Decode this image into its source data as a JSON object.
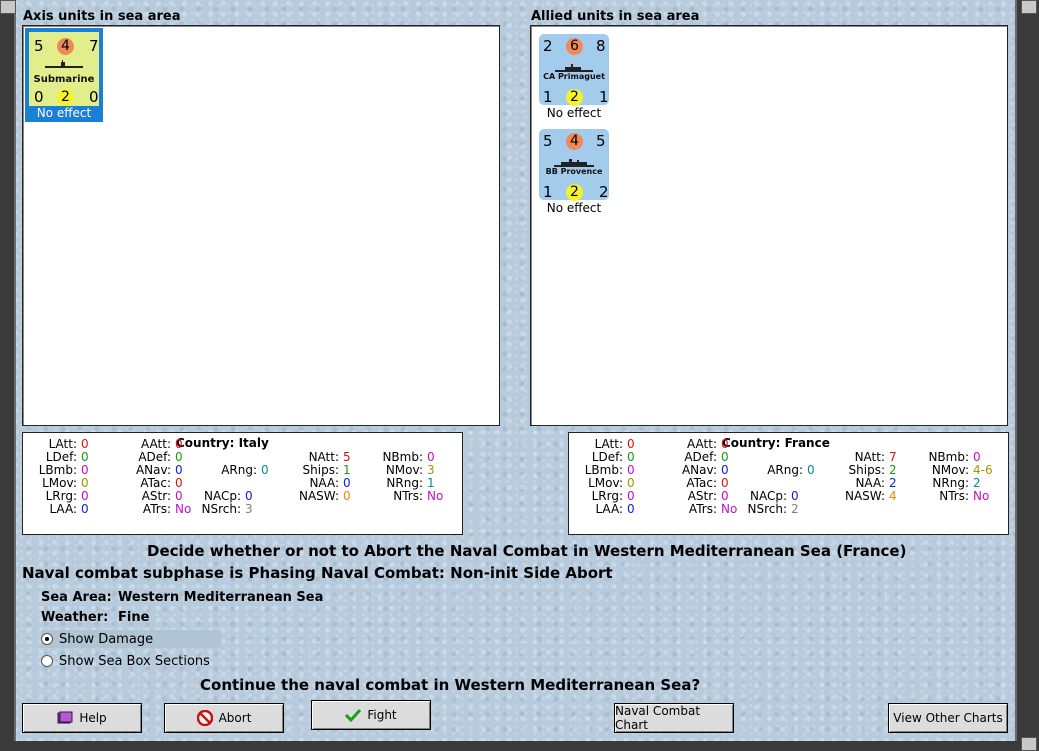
{
  "axis": {
    "title": "Axis units in sea area",
    "units": [
      {
        "name": "Submarine",
        "top_left": "5",
        "top_mid": "4",
        "top_right": "7",
        "bot_left": "0",
        "bot_mid": "2",
        "bot_right": "0",
        "effect": "No effect",
        "selected": true
      }
    ],
    "stats": {
      "country_label": "Country:",
      "country": "Italy",
      "LAtt": "0",
      "LDef": "0",
      "LBmb": "0",
      "LMov": "0",
      "LRrg": "0",
      "LAA": "0",
      "AAtt": "0",
      "ADef": "0",
      "ANav": "0",
      "ATac": "0",
      "AStr": "0",
      "ATrs": "No",
      "ARng": "0",
      "NACp": "0",
      "NSrch": "3",
      "NAtt": "5",
      "Ships": "1",
      "NAA": "0",
      "NASW": "0",
      "NBmb": "0",
      "NMov": "3",
      "NRng": "1",
      "NTrs": "No"
    }
  },
  "allied": {
    "title": "Allied units in sea area",
    "units": [
      {
        "name": "CA Primaguet",
        "top_left": "2",
        "top_mid": "6",
        "top_right": "8",
        "bot_left": "1",
        "bot_mid": "2",
        "bot_right": "1",
        "effect": "No effect"
      },
      {
        "name": "BB Provence",
        "top_left": "5",
        "top_mid": "4",
        "top_right": "5",
        "bot_left": "1",
        "bot_mid": "2",
        "bot_right": "2",
        "effect": "No effect"
      }
    ],
    "stats": {
      "country_label": "Country:",
      "country": "France",
      "LAtt": "0",
      "LDef": "0",
      "LBmb": "0",
      "LMov": "0",
      "LRrg": "0",
      "LAA": "0",
      "AAtt": "0",
      "ADef": "0",
      "ANav": "0",
      "ATac": "0",
      "AStr": "0",
      "ATrs": "No",
      "ARng": "0",
      "NACp": "0",
      "NSrch": "2",
      "NAtt": "7",
      "Ships": "2",
      "NAA": "2",
      "NASW": "4",
      "NBmb": "0",
      "NMov": "4-6",
      "NRng": "2",
      "NTrs": "No"
    }
  },
  "labels": {
    "LAtt": "LAtt:",
    "LDef": "LDef:",
    "LBmb": "LBmb:",
    "LMov": "LMov:",
    "LRrg": "LRrg:",
    "LAA": "LAA:",
    "AAtt": "AAtt:",
    "ADef": "ADef:",
    "ANav": "ANav:",
    "ATac": "ATac:",
    "AStr": "AStr:",
    "ATrs": "ATrs:",
    "ARng": "ARng:",
    "NACp": "NACp:",
    "NSrch": "NSrch:",
    "NAtt": "NAtt:",
    "Ships": "Ships:",
    "NAA": "NAA:",
    "NASW": "NASW:",
    "NBmb": "NBmb:",
    "NMov": "NMov:",
    "NRng": "NRng:",
    "NTrs": "NTrs:"
  },
  "colors": {
    "red": "#e01010",
    "green": "#10a010",
    "purple": "#c010c0",
    "olive": "#9a9a00",
    "blue": "#1020d0",
    "teal": "#0a8a9a",
    "orange": "#e08a10",
    "gray": "#808080",
    "selection": "#1c7fd6"
  },
  "messages": {
    "decide": "Decide whether or not to Abort the Naval Combat in Western Mediterranean Sea (France)",
    "subphase": "Naval combat subphase is Phasing Naval Combat: Non-init Side Abort",
    "sea_area_label": "Sea Area:",
    "sea_area": "Western Mediterranean Sea",
    "weather_label": "Weather:",
    "weather": "Fine",
    "show_damage": "Show Damage",
    "show_sections": "Show Sea Box Sections",
    "continue": "Continue the naval combat in Western Mediterranean Sea?"
  },
  "buttons": {
    "help": "Help",
    "abort": "Abort",
    "fight": "Fight",
    "naval_chart": "Naval Combat Chart",
    "other_charts": "View Other Charts"
  },
  "icons": {
    "help": "book-icon",
    "abort": "no-entry-icon",
    "fight": "checkmark-icon"
  }
}
